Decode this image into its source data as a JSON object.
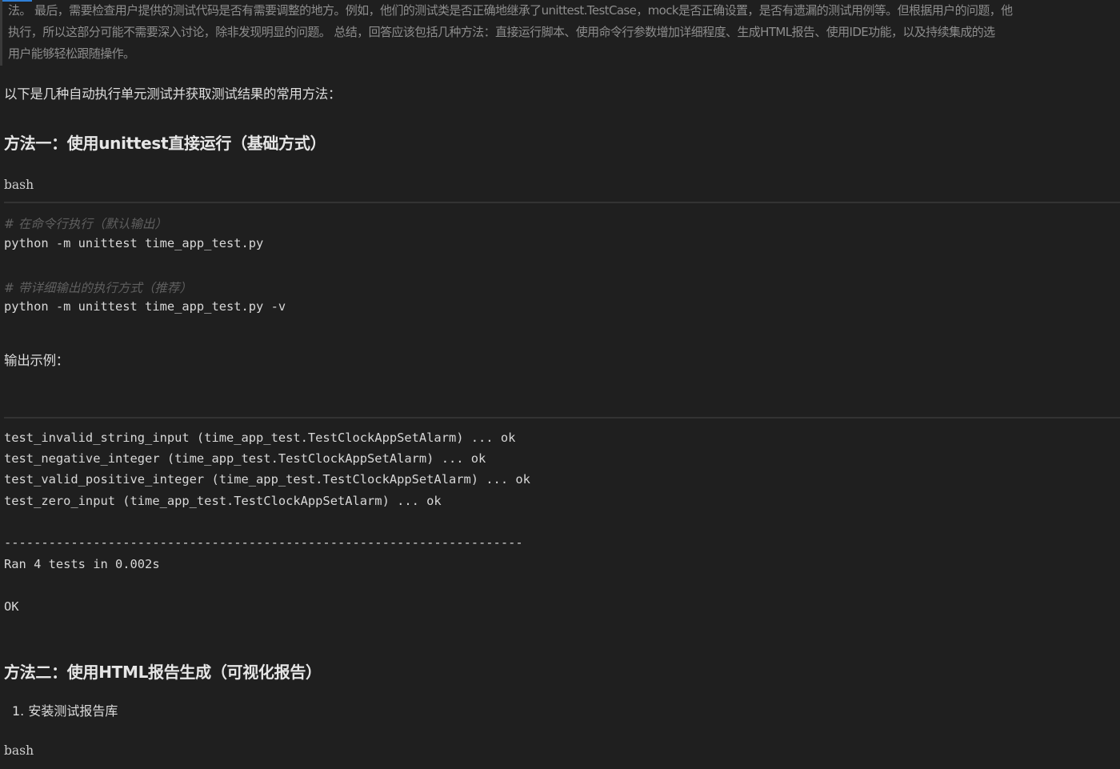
{
  "thinking": {
    "lines": [
      "法。 最后，需要检查用户提供的测试代码是否有需要调整的地方。例如，他们的测试类是否正确地继承了unittest.TestCase，mock是否正确设置，是否有遗漏的测试用例等。但根据用户的问题，他",
      "执行，所以这部分可能不需要深入讨论，除非发现明显的问题。 总结，回答应该包括几种方法：直接运行脚本、使用命令行参数增加详细程度、生成HTML报告、使用IDE功能，以及持续集成的选",
      "用户能够轻松跟随操作。"
    ]
  },
  "answer": {
    "intro": "以下是几种自动执行单元测试并获取测试结果的常用方法：",
    "method1": {
      "heading": "方法一：使用unittest直接运行（基础方式）",
      "code_lang": "bash",
      "code": {
        "comment1": "# 在命令行执行（默认输出）",
        "cmd1": "python -m unittest time_app_test.py",
        "comment2": "# 带详细输出的执行方式（推荐）",
        "cmd2": "python -m unittest time_app_test.py -v"
      },
      "output_label": "输出示例：",
      "output": {
        "lines": [
          "test_invalid_string_input (time_app_test.TestClockAppSetAlarm) ... ok",
          "test_negative_integer (time_app_test.TestClockAppSetAlarm) ... ok",
          "test_valid_positive_integer (time_app_test.TestClockAppSetAlarm) ... ok",
          "test_zero_input (time_app_test.TestClockAppSetAlarm) ... ok"
        ],
        "separator": "----------------------------------------------------------------------",
        "ran": "Ran 4 tests in 0.002s",
        "status": "OK"
      }
    },
    "method2": {
      "heading": "方法二：使用HTML报告生成（可视化报告）",
      "step1": "1. 安装测试报告库",
      "code_lang": "bash"
    }
  }
}
